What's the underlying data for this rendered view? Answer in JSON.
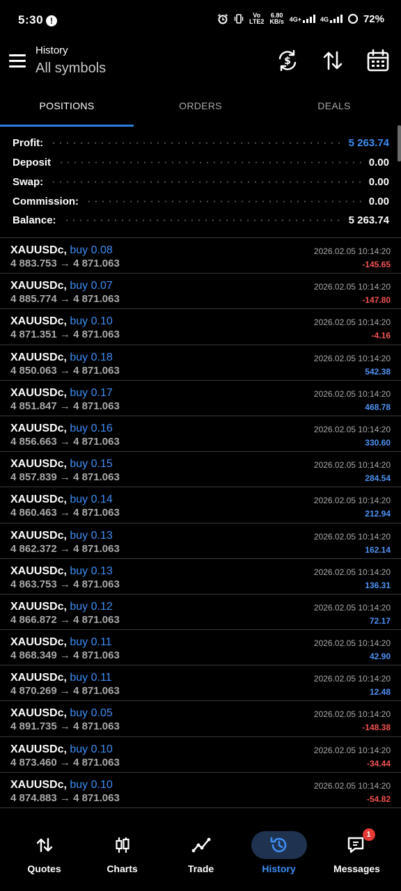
{
  "status_bar": {
    "time": "5:30",
    "network_1": "Vo LTE2",
    "speed": "6.80 KB/s",
    "network_2": "4G+",
    "network_3": "4G",
    "battery": "72%"
  },
  "header": {
    "title": "History",
    "subtitle": "All symbols"
  },
  "tabs": [
    {
      "label": "POSITIONS",
      "active": true
    },
    {
      "label": "ORDERS",
      "active": false
    },
    {
      "label": "DEALS",
      "active": false
    }
  ],
  "summary": [
    {
      "label": "Profit:",
      "value": "5 263.74"
    },
    {
      "label": "Deposit",
      "value": "0.00"
    },
    {
      "label": "Swap:",
      "value": "0.00"
    },
    {
      "label": "Commission:",
      "value": "0.00"
    },
    {
      "label": "Balance:",
      "value": "5 263.74"
    }
  ],
  "colors": {
    "accent": "#2d7fe0",
    "positive": "#4f93f5",
    "negative": "#f25252",
    "background": "#000000"
  },
  "positions": [
    {
      "symbol": "XAUUSDc,",
      "side": "buy 0.08",
      "prices": "4 883.753 → 4 871.063",
      "time": "2026.02.05 10:14:20",
      "profit": "-145.65"
    },
    {
      "symbol": "XAUUSDc,",
      "side": "buy 0.07",
      "prices": "4 885.774 → 4 871.063",
      "time": "2026.02.05 10:14:20",
      "profit": "-147.80"
    },
    {
      "symbol": "XAUUSDc,",
      "side": "buy 0.10",
      "prices": "4 871.351 → 4 871.063",
      "time": "2026.02.05 10:14:20",
      "profit": "-4.16"
    },
    {
      "symbol": "XAUUSDc,",
      "side": "buy 0.18",
      "prices": "4 850.063 → 4 871.063",
      "time": "2026.02.05 10:14:20",
      "profit": "542.38"
    },
    {
      "symbol": "XAUUSDc,",
      "side": "buy 0.17",
      "prices": "4 851.847 → 4 871.063",
      "time": "2026.02.05 10:14:20",
      "profit": "468.78"
    },
    {
      "symbol": "XAUUSDc,",
      "side": "buy 0.16",
      "prices": "4 856.663 → 4 871.063",
      "time": "2026.02.05 10:14:20",
      "profit": "330.60"
    },
    {
      "symbol": "XAUUSDc,",
      "side": "buy 0.15",
      "prices": "4 857.839 → 4 871.063",
      "time": "2026.02.05 10:14:20",
      "profit": "284.54"
    },
    {
      "symbol": "XAUUSDc,",
      "side": "buy 0.14",
      "prices": "4 860.463 → 4 871.063",
      "time": "2026.02.05 10:14:20",
      "profit": "212.94"
    },
    {
      "symbol": "XAUUSDc,",
      "side": "buy 0.13",
      "prices": "4 862.372 → 4 871.063",
      "time": "2026.02.05 10:14:20",
      "profit": "162.14"
    },
    {
      "symbol": "XAUUSDc,",
      "side": "buy 0.13",
      "prices": "4 863.753 → 4 871.063",
      "time": "2026.02.05 10:14:20",
      "profit": "136.31"
    },
    {
      "symbol": "XAUUSDc,",
      "side": "buy 0.12",
      "prices": "4 866.872 → 4 871.063",
      "time": "2026.02.05 10:14:20",
      "profit": "72.17"
    },
    {
      "symbol": "XAUUSDc,",
      "side": "buy 0.11",
      "prices": "4 868.349 → 4 871.063",
      "time": "2026.02.05 10:14:20",
      "profit": "42.90"
    },
    {
      "symbol": "XAUUSDc,",
      "side": "buy 0.11",
      "prices": "4 870.269 → 4 871.063",
      "time": "2026.02.05 10:14:20",
      "profit": "12.48"
    },
    {
      "symbol": "XAUUSDc,",
      "side": "buy 0.05",
      "prices": "4 891.735 → 4 871.063",
      "time": "2026.02.05 10:14:20",
      "profit": "-148.38"
    },
    {
      "symbol": "XAUUSDc,",
      "side": "buy 0.10",
      "prices": "4 873.460 → 4 871.063",
      "time": "2026.02.05 10:14:20",
      "profit": "-34.44"
    },
    {
      "symbol": "XAUUSDc,",
      "side": "buy 0.10",
      "prices": "4 874.883 → 4 871.063",
      "time": "2026.02.05 10:14:20",
      "profit": "-54.82"
    }
  ],
  "bottom_nav": [
    {
      "label": "Quotes",
      "icon": "quotes-icon",
      "active": false
    },
    {
      "label": "Charts",
      "icon": "charts-icon",
      "active": false
    },
    {
      "label": "Trade",
      "icon": "trade-icon",
      "active": false
    },
    {
      "label": "History",
      "icon": "history-icon",
      "active": true
    },
    {
      "label": "Messages",
      "icon": "messages-icon",
      "active": false,
      "badge": "1"
    }
  ]
}
